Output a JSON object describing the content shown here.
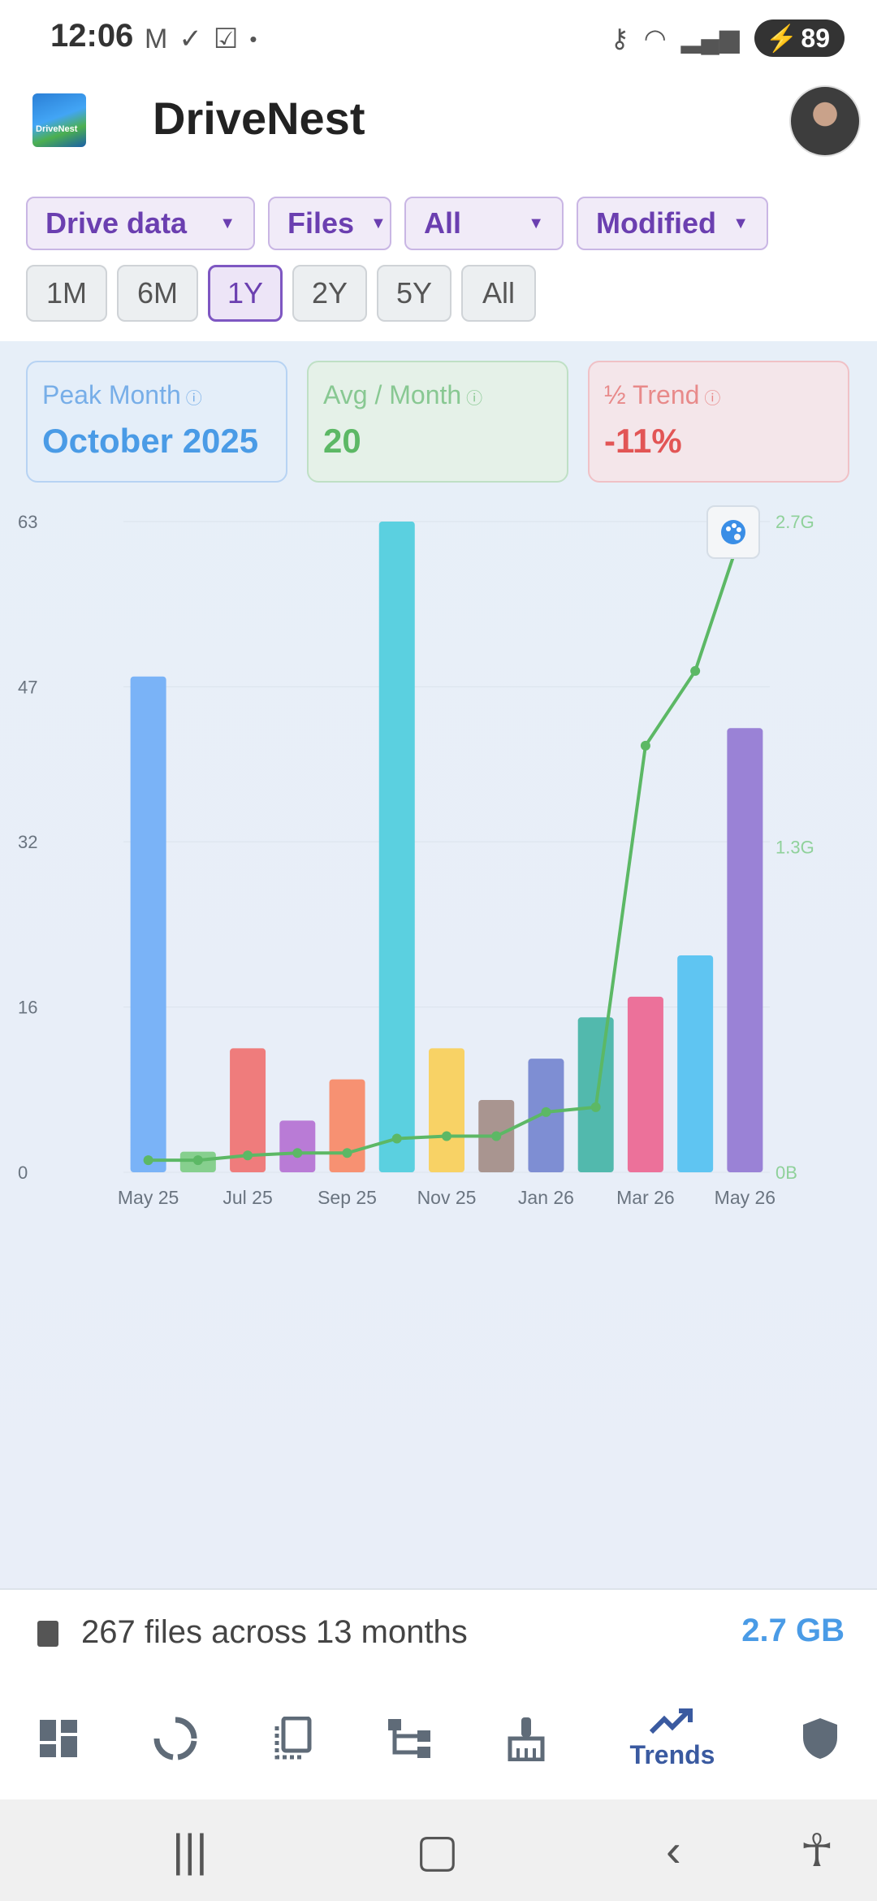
{
  "status_bar": {
    "time": "12:06",
    "left_icons": [
      "gmail-icon",
      "check-circle-icon",
      "checkbox-icon",
      "dot-icon"
    ],
    "right_icons": [
      "key-icon",
      "wifi-icon",
      "signal-icon"
    ],
    "battery": "89"
  },
  "app": {
    "title": "DriveNest",
    "logo_text": "DriveNest"
  },
  "filters": [
    {
      "label": "Drive data",
      "width": 282
    },
    {
      "label": "Files",
      "width": 152
    },
    {
      "label": "All",
      "width": 196
    },
    {
      "label": "Modified",
      "width": 236
    }
  ],
  "ranges": [
    {
      "label": "1M",
      "active": false
    },
    {
      "label": "6M",
      "active": false
    },
    {
      "label": "1Y",
      "active": true
    },
    {
      "label": "2Y",
      "active": false
    },
    {
      "label": "5Y",
      "active": false
    },
    {
      "label": "All",
      "active": false
    }
  ],
  "stats": {
    "peak": {
      "label": "Peak Month",
      "value": "October 2025"
    },
    "avg": {
      "label": "Avg / Month",
      "value": "20"
    },
    "trend": {
      "label": "½ Trend",
      "value": "-11%"
    }
  },
  "chart_data": {
    "type": "bar",
    "categories": [
      "May 25",
      "Jun 25",
      "Jul 25",
      "Aug 25",
      "Sep 25",
      "Oct 25",
      "Nov 25",
      "Dec 25",
      "Jan 26",
      "Feb 26",
      "Mar 26",
      "Apr 26",
      "May 26"
    ],
    "x_tick_labels": [
      "May 25",
      "Jul 25",
      "Sep 25",
      "Nov 25",
      "Jan 26",
      "Mar 26",
      "May 26"
    ],
    "series": [
      {
        "values": [
          48,
          2,
          12,
          5,
          9,
          63,
          12,
          7,
          11,
          15,
          17,
          21,
          43
        ]
      },
      {
        "type": "line",
        "axis": "right",
        "values": [
          0.05,
          0.05,
          0.07,
          0.08,
          0.08,
          0.14,
          0.15,
          0.15,
          0.25,
          0.27,
          1.77,
          2.08,
          2.7
        ]
      }
    ],
    "bar_colors": [
      "#7ab3f7",
      "#86cf8e",
      "#ef7c7c",
      "#b97bd6",
      "#f79172",
      "#5bd0e0",
      "#f8d265",
      "#a99590",
      "#7e8ed3",
      "#52b9ad",
      "#ec719a",
      "#5fc5f2",
      "#9a82d6"
    ],
    "line_color": "#5cb865",
    "left_axis": {
      "ticks": [
        "0",
        "16",
        "32",
        "47",
        "63"
      ],
      "range": [
        0,
        63
      ]
    },
    "right_axis": {
      "ticks": [
        "0B",
        "1.3G",
        "2.7G"
      ],
      "range": [
        0,
        2.7
      ],
      "unit": "GB"
    },
    "grid": true
  },
  "summary": {
    "text": "267 files across 13 months",
    "size": "2.7 GB"
  },
  "bottom_nav": {
    "items": [
      "dashboard-icon",
      "sync-icon",
      "copy-icon",
      "tree-icon",
      "broom-icon",
      "trends-icon",
      "shield-icon"
    ],
    "active_label": "Trends"
  }
}
